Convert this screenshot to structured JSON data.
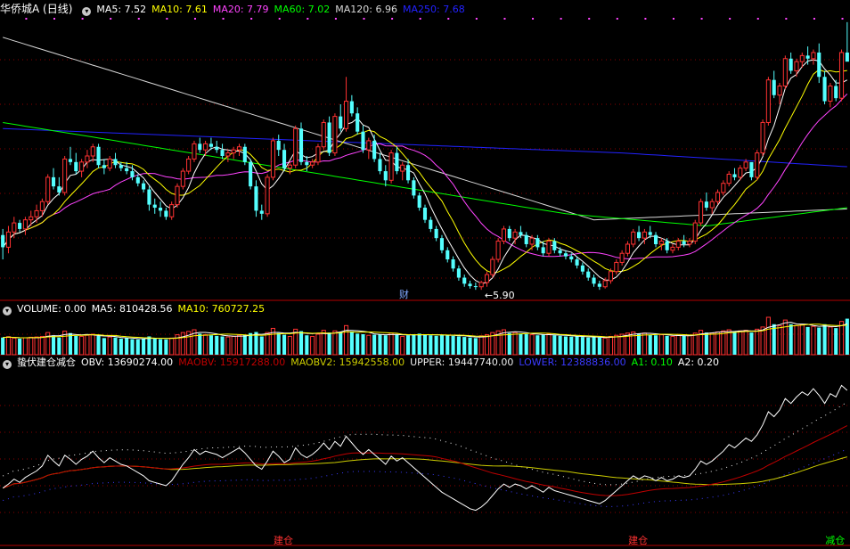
{
  "colors": {
    "rise": "#ff3232",
    "fall": "#54ffff",
    "grid": "#8b0000",
    "bg": "#000000",
    "ma5": "#ffffff",
    "ma10": "#ffff00",
    "ma20": "#ff44ff",
    "ma60": "#00ff00",
    "ma120": "#d8d8d8",
    "ma250": "#2222ff",
    "obv": "#ffffff",
    "maobv": "#c00000",
    "maobv2": "#cccc00",
    "upper": "#eeeeee",
    "lower": "#3a3aff",
    "signal_buy": "#ff3232",
    "signal_sell": "#00ff00"
  },
  "price_panel": {
    "title": "华侨城A (日线)",
    "ma_labels": [
      {
        "text": "MA5: 7.52",
        "color": "#ffffff"
      },
      {
        "text": "MA10: 7.61",
        "color": "#ffff00"
      },
      {
        "text": "MA20: 7.79",
        "color": "#ff44ff"
      },
      {
        "text": "MA60: 7.02",
        "color": "#00ff00"
      },
      {
        "text": "MA120: 6.96",
        "color": "#d8d8d8"
      },
      {
        "text": "MA250: 7.68",
        "color": "#2222ff"
      }
    ],
    "low_marker": "5.90",
    "event_badge": "财"
  },
  "volume_panel": {
    "title": "VOLUME: 0.00",
    "labels": [
      {
        "text": "MA5: 810428.56",
        "color": "#ffffff"
      },
      {
        "text": "MA10: 760727.25",
        "color": "#ffff00"
      }
    ]
  },
  "indicator_panel": {
    "title": "蛰伏建仓减仓",
    "labels": [
      {
        "text": "OBV: 13690274.00",
        "color": "#ffffff"
      },
      {
        "text": "MAOBV: 15917288.00",
        "color": "#c00000"
      },
      {
        "text": "MAOBV2: 15942558.00",
        "color": "#cccc00"
      },
      {
        "text": "UPPER: 19447740.00",
        "color": "#eeeeee"
      },
      {
        "text": "LOWER: 12388836.00",
        "color": "#3a3aff"
      },
      {
        "text": "A1: 0.10",
        "color": "#00ff00"
      },
      {
        "text": "A2: 0.20",
        "color": "#ffffff"
      }
    ],
    "signals": [
      {
        "text": "建仓",
        "color": "#ff3232",
        "index": 50
      },
      {
        "text": "建仓",
        "color": "#ff3232",
        "index": 113
      },
      {
        "text": "减仓",
        "color": "#00ff00",
        "index": 148
      }
    ]
  },
  "chart_data": {
    "type": "candlestick",
    "count": 156,
    "ohlc": [
      [
        6.8,
        6.9,
        6.4,
        6.6
      ],
      [
        6.6,
        6.95,
        6.5,
        6.85
      ],
      [
        6.85,
        7.1,
        6.75,
        7.0
      ],
      [
        7.0,
        7.05,
        6.85,
        6.9
      ],
      [
        6.9,
        7.1,
        6.8,
        7.05
      ],
      [
        7.05,
        7.2,
        6.95,
        7.1
      ],
      [
        7.1,
        7.3,
        7.0,
        7.2
      ],
      [
        7.2,
        7.4,
        7.1,
        7.35
      ],
      [
        7.35,
        7.8,
        7.3,
        7.75
      ],
      [
        7.75,
        7.9,
        7.55,
        7.6
      ],
      [
        7.6,
        7.75,
        7.45,
        7.5
      ],
      [
        7.5,
        8.1,
        7.45,
        8.05
      ],
      [
        8.05,
        8.25,
        7.95,
        8.0
      ],
      [
        8.0,
        8.15,
        7.8,
        7.85
      ],
      [
        7.85,
        8.05,
        7.75,
        8.0
      ],
      [
        8.0,
        8.2,
        7.9,
        8.1
      ],
      [
        8.1,
        8.3,
        8.0,
        8.25
      ],
      [
        8.25,
        8.3,
        7.9,
        7.95
      ],
      [
        7.95,
        8.05,
        7.8,
        7.9
      ],
      [
        7.9,
        8.1,
        7.85,
        8.05
      ],
      [
        8.05,
        8.15,
        7.9,
        7.95
      ],
      [
        7.95,
        8.0,
        7.85,
        7.9
      ],
      [
        7.9,
        8.0,
        7.8,
        7.85
      ],
      [
        7.85,
        7.95,
        7.7,
        7.75
      ],
      [
        7.75,
        7.8,
        7.6,
        7.65
      ],
      [
        7.65,
        7.7,
        7.5,
        7.55
      ],
      [
        7.55,
        7.6,
        7.2,
        7.3
      ],
      [
        7.3,
        7.4,
        7.15,
        7.25
      ],
      [
        7.25,
        7.35,
        7.1,
        7.2
      ],
      [
        7.2,
        7.25,
        7.05,
        7.1
      ],
      [
        7.1,
        7.35,
        7.05,
        7.3
      ],
      [
        7.3,
        7.65,
        7.25,
        7.6
      ],
      [
        7.6,
        7.9,
        7.55,
        7.85
      ],
      [
        7.85,
        8.1,
        7.8,
        8.05
      ],
      [
        8.05,
        8.35,
        8.0,
        8.3
      ],
      [
        8.3,
        8.4,
        8.15,
        8.2
      ],
      [
        8.2,
        8.35,
        8.1,
        8.3
      ],
      [
        8.3,
        8.4,
        8.2,
        8.25
      ],
      [
        8.25,
        8.35,
        8.15,
        8.2
      ],
      [
        8.2,
        8.3,
        8.05,
        8.1
      ],
      [
        8.1,
        8.2,
        8.0,
        8.15
      ],
      [
        8.15,
        8.25,
        8.05,
        8.2
      ],
      [
        8.2,
        8.3,
        8.1,
        8.25
      ],
      [
        8.25,
        8.3,
        7.95,
        8.0
      ],
      [
        8.0,
        8.05,
        7.55,
        7.6
      ],
      [
        7.6,
        7.7,
        7.1,
        7.2
      ],
      [
        7.2,
        7.3,
        7.05,
        7.15
      ],
      [
        7.15,
        7.8,
        7.1,
        7.75
      ],
      [
        7.75,
        8.4,
        7.7,
        8.35
      ],
      [
        8.35,
        8.45,
        8.1,
        8.2
      ],
      [
        8.2,
        8.3,
        7.85,
        7.9
      ],
      [
        7.9,
        8.0,
        7.8,
        7.95
      ],
      [
        7.95,
        8.6,
        7.9,
        8.55
      ],
      [
        8.55,
        8.65,
        7.95,
        8.0
      ],
      [
        8.0,
        8.1,
        7.85,
        7.95
      ],
      [
        7.95,
        8.05,
        7.9,
        8.0
      ],
      [
        8.0,
        8.3,
        7.95,
        8.25
      ],
      [
        8.25,
        8.7,
        8.2,
        8.65
      ],
      [
        8.65,
        8.75,
        8.1,
        8.15
      ],
      [
        8.15,
        8.8,
        8.1,
        8.75
      ],
      [
        8.75,
        8.95,
        8.5,
        8.55
      ],
      [
        8.55,
        9.4,
        8.5,
        9.0
      ],
      [
        9.0,
        9.1,
        8.75,
        8.8
      ],
      [
        8.8,
        8.9,
        8.45,
        8.5
      ],
      [
        8.5,
        8.6,
        8.15,
        8.2
      ],
      [
        8.2,
        8.4,
        8.05,
        8.35
      ],
      [
        8.35,
        8.45,
        8.0,
        8.05
      ],
      [
        8.05,
        8.15,
        7.8,
        7.85
      ],
      [
        7.85,
        7.95,
        7.6,
        7.7
      ],
      [
        7.7,
        8.2,
        7.65,
        8.15
      ],
      [
        8.15,
        8.25,
        7.8,
        7.85
      ],
      [
        7.85,
        8.0,
        7.7,
        7.95
      ],
      [
        7.95,
        8.05,
        7.65,
        7.7
      ],
      [
        7.7,
        7.75,
        7.4,
        7.45
      ],
      [
        7.45,
        7.5,
        7.2,
        7.25
      ],
      [
        7.25,
        7.3,
        7.0,
        7.05
      ],
      [
        7.05,
        7.1,
        6.85,
        6.9
      ],
      [
        6.9,
        6.95,
        6.7,
        6.75
      ],
      [
        6.75,
        6.8,
        6.5,
        6.55
      ],
      [
        6.55,
        6.6,
        6.35,
        6.4
      ],
      [
        6.4,
        6.45,
        6.2,
        6.25
      ],
      [
        6.25,
        6.3,
        6.05,
        6.1
      ],
      [
        6.1,
        6.15,
        5.95,
        6.0
      ],
      [
        6.0,
        6.05,
        5.92,
        5.96
      ],
      [
        5.96,
        6.02,
        5.9,
        5.95
      ],
      [
        5.95,
        6.05,
        5.9,
        6.02
      ],
      [
        6.02,
        6.2,
        5.95,
        6.15
      ],
      [
        6.15,
        6.45,
        6.1,
        6.4
      ],
      [
        6.4,
        6.75,
        6.35,
        6.7
      ],
      [
        6.7,
        6.95,
        6.65,
        6.9
      ],
      [
        6.9,
        6.95,
        6.7,
        6.75
      ],
      [
        6.75,
        6.9,
        6.65,
        6.85
      ],
      [
        6.85,
        6.95,
        6.75,
        6.8
      ],
      [
        6.8,
        6.85,
        6.6,
        6.65
      ],
      [
        6.65,
        6.8,
        6.55,
        6.75
      ],
      [
        6.75,
        6.8,
        6.55,
        6.6
      ],
      [
        6.6,
        6.7,
        6.45,
        6.5
      ],
      [
        6.5,
        6.75,
        6.45,
        6.7
      ],
      [
        6.7,
        6.75,
        6.5,
        6.55
      ],
      [
        6.55,
        6.6,
        6.45,
        6.5
      ],
      [
        6.5,
        6.55,
        6.4,
        6.45
      ],
      [
        6.45,
        6.5,
        6.35,
        6.4
      ],
      [
        6.4,
        6.45,
        6.25,
        6.3
      ],
      [
        6.3,
        6.35,
        6.15,
        6.2
      ],
      [
        6.2,
        6.25,
        6.05,
        6.1
      ],
      [
        6.1,
        6.15,
        5.95,
        6.0
      ],
      [
        6.0,
        6.05,
        5.9,
        5.95
      ],
      [
        5.95,
        6.1,
        5.92,
        6.05
      ],
      [
        6.05,
        6.25,
        6.0,
        6.2
      ],
      [
        6.2,
        6.4,
        6.15,
        6.35
      ],
      [
        6.35,
        6.55,
        6.3,
        6.5
      ],
      [
        6.5,
        6.7,
        6.45,
        6.65
      ],
      [
        6.65,
        6.9,
        6.6,
        6.85
      ],
      [
        6.85,
        6.95,
        6.7,
        6.75
      ],
      [
        6.75,
        6.9,
        6.65,
        6.85
      ],
      [
        6.85,
        6.95,
        6.75,
        6.8
      ],
      [
        6.8,
        6.85,
        6.6,
        6.65
      ],
      [
        6.65,
        6.75,
        6.55,
        6.7
      ],
      [
        6.7,
        6.75,
        6.5,
        6.55
      ],
      [
        6.55,
        6.65,
        6.5,
        6.6
      ],
      [
        6.6,
        6.75,
        6.55,
        6.7
      ],
      [
        6.7,
        6.8,
        6.6,
        6.65
      ],
      [
        6.65,
        6.75,
        6.6,
        6.7
      ],
      [
        6.7,
        7.05,
        6.65,
        7.0
      ],
      [
        7.0,
        7.4,
        6.95,
        7.35
      ],
      [
        7.35,
        7.5,
        7.2,
        7.25
      ],
      [
        7.25,
        7.4,
        7.15,
        7.35
      ],
      [
        7.35,
        7.55,
        7.3,
        7.5
      ],
      [
        7.5,
        7.7,
        7.45,
        7.65
      ],
      [
        7.65,
        7.85,
        7.6,
        7.8
      ],
      [
        7.8,
        7.9,
        7.7,
        7.75
      ],
      [
        7.75,
        7.95,
        7.7,
        7.9
      ],
      [
        7.9,
        8.05,
        7.85,
        8.0
      ],
      [
        8.0,
        7.85,
        7.7,
        7.75
      ],
      [
        7.75,
        8.2,
        7.7,
        8.15
      ],
      [
        8.15,
        8.7,
        8.1,
        8.65
      ],
      [
        8.65,
        9.4,
        8.6,
        9.35
      ],
      [
        9.35,
        9.5,
        9.05,
        9.1
      ],
      [
        9.1,
        9.3,
        8.95,
        9.25
      ],
      [
        9.25,
        9.75,
        9.2,
        9.7
      ],
      [
        9.7,
        9.8,
        9.45,
        9.5
      ],
      [
        9.5,
        9.7,
        9.4,
        9.65
      ],
      [
        9.65,
        9.8,
        9.55,
        9.75
      ],
      [
        9.75,
        9.9,
        9.6,
        9.7
      ],
      [
        9.7,
        9.85,
        9.6,
        9.8
      ],
      [
        9.8,
        9.95,
        9.3,
        9.4
      ],
      [
        9.4,
        9.5,
        8.95,
        9.0
      ],
      [
        9.0,
        9.3,
        8.9,
        9.25
      ],
      [
        9.25,
        9.35,
        9.0,
        9.05
      ],
      [
        9.05,
        9.85,
        9.0,
        9.8
      ],
      [
        9.8,
        10.3,
        9.75,
        9.65
      ]
    ],
    "y_range": [
      5.8,
      10.4
    ],
    "volume": [
      0.62,
      0.65,
      0.6,
      0.58,
      0.61,
      0.63,
      0.64,
      0.66,
      0.8,
      0.7,
      0.62,
      0.85,
      0.78,
      0.68,
      0.66,
      0.7,
      0.74,
      0.68,
      0.6,
      0.64,
      0.62,
      0.58,
      0.6,
      0.56,
      0.55,
      0.58,
      0.66,
      0.6,
      0.56,
      0.55,
      0.6,
      0.72,
      0.8,
      0.84,
      0.9,
      0.76,
      0.72,
      0.7,
      0.68,
      0.66,
      0.64,
      0.66,
      0.7,
      0.72,
      0.78,
      0.82,
      0.66,
      0.8,
      0.95,
      0.78,
      0.72,
      0.66,
      0.92,
      0.85,
      0.7,
      0.66,
      0.74,
      0.88,
      0.8,
      0.86,
      0.82,
      1.05,
      0.84,
      0.76,
      0.74,
      0.7,
      0.72,
      0.74,
      0.7,
      0.78,
      0.72,
      0.66,
      0.7,
      0.74,
      0.76,
      0.72,
      0.7,
      0.68,
      0.72,
      0.7,
      0.68,
      0.66,
      0.64,
      0.62,
      0.6,
      0.68,
      0.72,
      0.8,
      0.86,
      0.9,
      0.78,
      0.8,
      0.76,
      0.74,
      0.72,
      0.7,
      0.72,
      0.74,
      0.7,
      0.68,
      0.66,
      0.65,
      0.66,
      0.64,
      0.62,
      0.64,
      0.62,
      0.6,
      0.66,
      0.7,
      0.74,
      0.78,
      0.82,
      0.76,
      0.78,
      0.72,
      0.7,
      0.72,
      0.68,
      0.66,
      0.7,
      0.68,
      0.7,
      0.78,
      0.88,
      0.8,
      0.78,
      0.82,
      0.86,
      0.9,
      0.84,
      0.86,
      0.88,
      0.8,
      0.92,
      1.0,
      1.35,
      1.1,
      1.05,
      1.25,
      1.1,
      1.05,
      1.08,
      1.0,
      1.02,
      0.98,
      1.1,
      1.0,
      0.96,
      1.2,
      1.3
    ],
    "volume_unit": "M",
    "obv": [
      0.55,
      0.6,
      0.66,
      0.62,
      0.68,
      0.72,
      0.76,
      0.82,
      0.95,
      0.88,
      0.82,
      0.95,
      0.9,
      0.84,
      0.9,
      0.94,
      1.0,
      0.92,
      0.86,
      0.92,
      0.88,
      0.84,
      0.82,
      0.78,
      0.74,
      0.7,
      0.64,
      0.62,
      0.6,
      0.58,
      0.64,
      0.74,
      0.84,
      0.92,
      1.02,
      0.96,
      1.0,
      0.98,
      0.96,
      0.92,
      0.96,
      1.0,
      1.04,
      0.98,
      0.9,
      0.82,
      0.78,
      0.88,
      1.0,
      0.94,
      0.86,
      0.9,
      1.04,
      0.96,
      0.92,
      0.96,
      1.02,
      1.1,
      1.02,
      1.12,
      1.06,
      1.18,
      1.1,
      1.02,
      0.96,
      1.02,
      0.96,
      0.9,
      0.84,
      0.94,
      0.88,
      0.92,
      0.86,
      0.8,
      0.74,
      0.68,
      0.62,
      0.56,
      0.5,
      0.46,
      0.42,
      0.38,
      0.34,
      0.3,
      0.28,
      0.32,
      0.38,
      0.46,
      0.54,
      0.6,
      0.56,
      0.6,
      0.58,
      0.54,
      0.58,
      0.54,
      0.5,
      0.56,
      0.52,
      0.5,
      0.48,
      0.46,
      0.44,
      0.42,
      0.4,
      0.38,
      0.36,
      0.4,
      0.46,
      0.52,
      0.58,
      0.64,
      0.7,
      0.66,
      0.7,
      0.68,
      0.64,
      0.68,
      0.64,
      0.66,
      0.7,
      0.68,
      0.7,
      0.78,
      0.88,
      0.84,
      0.88,
      0.94,
      1.0,
      1.08,
      1.04,
      1.1,
      1.16,
      1.12,
      1.2,
      1.32,
      1.48,
      1.42,
      1.5,
      1.64,
      1.58,
      1.66,
      1.72,
      1.68,
      1.76,
      1.68,
      1.58,
      1.7,
      1.66,
      1.8,
      1.74
    ],
    "obv_unit": "10M"
  }
}
